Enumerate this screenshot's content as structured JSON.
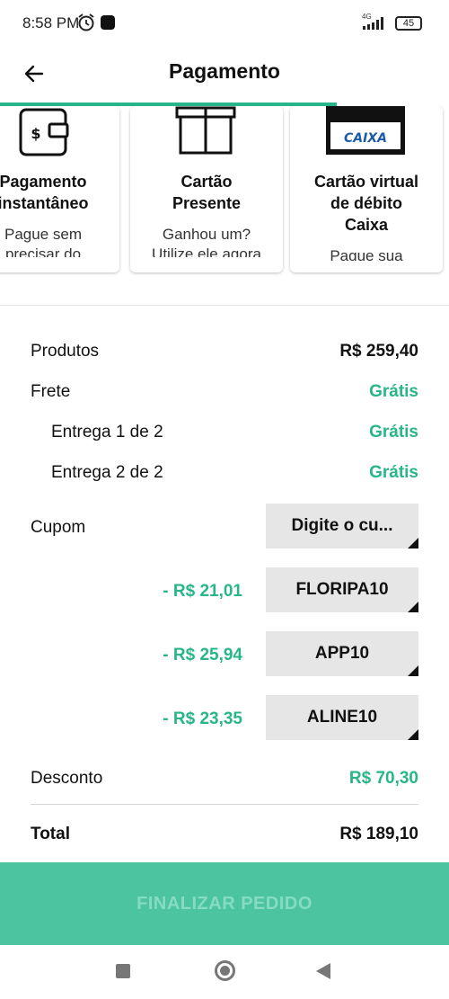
{
  "status": {
    "time": "8:58 PM",
    "network": "4G",
    "battery": "45"
  },
  "header": {
    "title": "Pagamento"
  },
  "cards": [
    {
      "icon": "wallet-icon",
      "title_line1": "Pagamento",
      "title_line2": "instantâneo",
      "title_line3": "",
      "desc_line1": "Pague sem",
      "desc_line2": "precisar do"
    },
    {
      "icon": "gift-card-icon",
      "title_line1": "Cartão",
      "title_line2": "Presente",
      "title_line3": "",
      "desc_line1": "Ganhou um?",
      "desc_line2": "Utilize ele agora"
    },
    {
      "icon": "caixa-card-icon",
      "logo_text": "CAIXA",
      "title_line1": "Cartão virtual",
      "title_line2": "de débito",
      "title_line3": "Caixa",
      "desc_line1": "Pague sua",
      "desc_line2": ""
    }
  ],
  "summary": {
    "produtos_label": "Produtos",
    "produtos_value": "R$ 259,40",
    "frete_label": "Frete",
    "frete_value": "Grátis",
    "deliveries": [
      {
        "label": "Entrega 1 de 2",
        "value": "Grátis"
      },
      {
        "label": "Entrega 2 de 2",
        "value": "Grátis"
      }
    ],
    "cupom_label": "Cupom",
    "cupom_placeholder": "Digite o cu...",
    "coupons": [
      {
        "amount": "- R$ 21,01",
        "code": "FLORIPA10"
      },
      {
        "amount": "- R$ 25,94",
        "code": "APP10"
      },
      {
        "amount": "- R$ 23,35",
        "code": "ALINE10"
      }
    ],
    "desconto_label": "Desconto",
    "desconto_value": "R$ 70,30",
    "total_label": "Total",
    "total_value": "R$ 189,10"
  },
  "actions": {
    "finish_label": "FINALIZAR PEDIDO"
  },
  "colors": {
    "accent": "#28b589",
    "button": "#4cc49f",
    "button_text": "#86dcc0"
  }
}
